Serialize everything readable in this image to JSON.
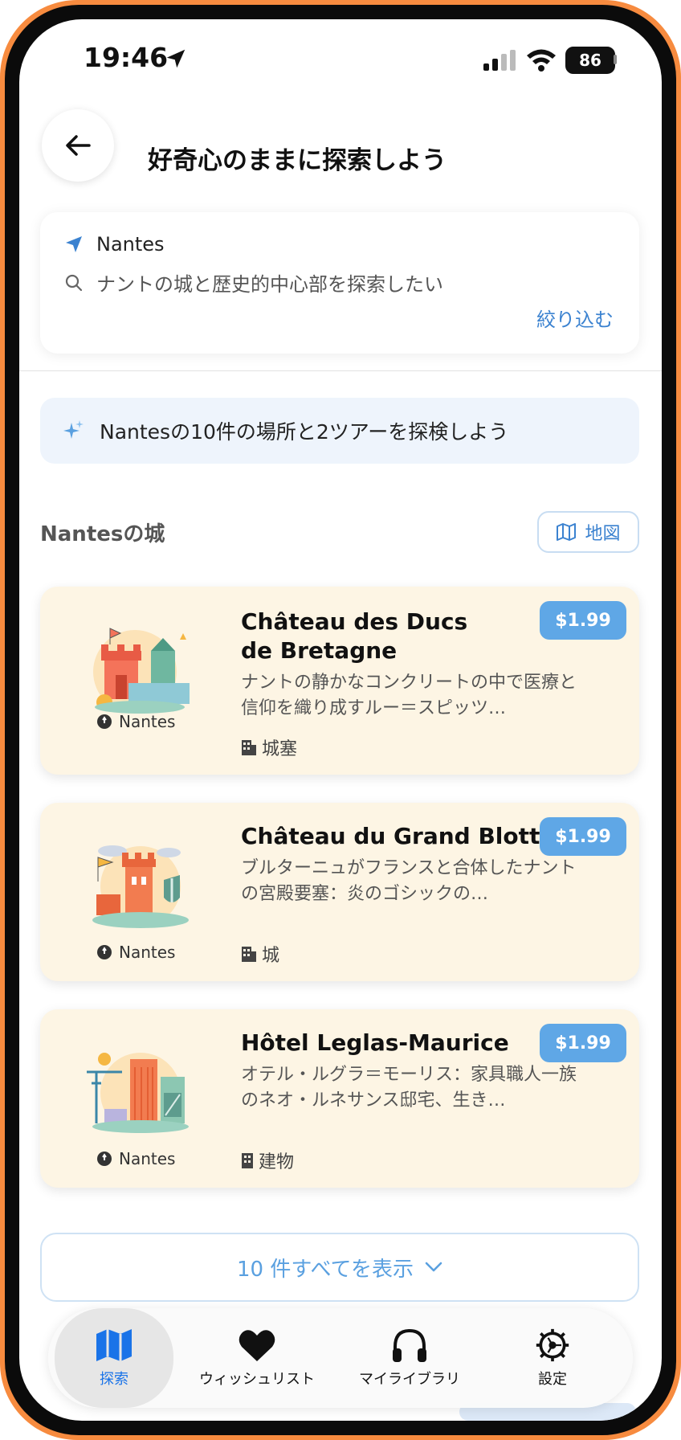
{
  "status": {
    "time": "19:46",
    "battery": "86"
  },
  "header": {
    "title": "好奇心のままに探索しよう"
  },
  "search": {
    "location": "Nantes",
    "query": "ナントの城と歴史的中心部を探索したい",
    "filter": "絞り込む"
  },
  "banner": {
    "text": "Nantesの10件の場所と2ツアーを探検しよう"
  },
  "section": {
    "title": "Nantesの城",
    "map_button": "地図"
  },
  "cards": [
    {
      "name": "Château des Ducs\nde Bretagne",
      "description": "ナントの静かなコンクリートの中で医療と信仰を織り成すルー＝スピッツ…",
      "city": "Nantes",
      "type": "城塞",
      "price": "$1.99"
    },
    {
      "name": "Château du Grand Blottereau",
      "description": "ブルターニュがフランスと合体したナントの宮殿要塞：炎のゴシックの…",
      "city": "Nantes",
      "type": "城",
      "price": "$1.99"
    },
    {
      "name": "Hôtel Leglas-Maurice",
      "description": "オテル・ルグラ＝モーリス：家具職人一族のネオ・ルネサンス邸宅、生き…",
      "city": "Nantes",
      "type": "建物",
      "price": "$1.99"
    }
  ],
  "show_all": "10 件すべてを表示",
  "nav": {
    "items": [
      {
        "label": "探索",
        "icon": "map-icon",
        "active": true
      },
      {
        "label": "ウィッシュリスト",
        "icon": "heart-icon"
      },
      {
        "label": "マイライブラリ",
        "icon": "headphones-icon"
      },
      {
        "label": "設定",
        "icon": "gear-icon"
      }
    ]
  },
  "colors": {
    "accent": "#3B82D0",
    "card_bg": "#FDF5E4",
    "price_bg": "#5FA7E6",
    "frame": "#F78B3F"
  }
}
